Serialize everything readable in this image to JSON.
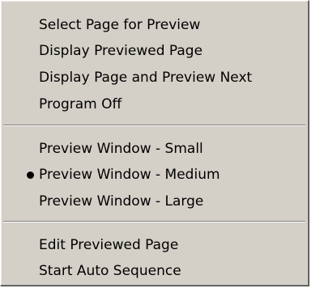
{
  "menu": {
    "group1": [
      {
        "label": "Select Page for Preview"
      },
      {
        "label": "Display Previewed Page"
      },
      {
        "label": "Display Page and Preview Next"
      },
      {
        "label": "Program Off"
      }
    ],
    "group2": [
      {
        "label": "Preview Window - Small",
        "checked": false
      },
      {
        "label": "Preview Window - Medium",
        "checked": true
      },
      {
        "label": "Preview Window - Large",
        "checked": false
      }
    ],
    "group3": [
      {
        "label": "Edit Previewed Page"
      },
      {
        "label": "Start Auto Sequence"
      }
    ],
    "icons": {
      "checked_indicator": "radio-bullet-icon"
    },
    "colors": {
      "background": "#d4d0c8",
      "text": "#000000",
      "separator_dark": "#808080",
      "separator_light": "#ffffff"
    }
  }
}
